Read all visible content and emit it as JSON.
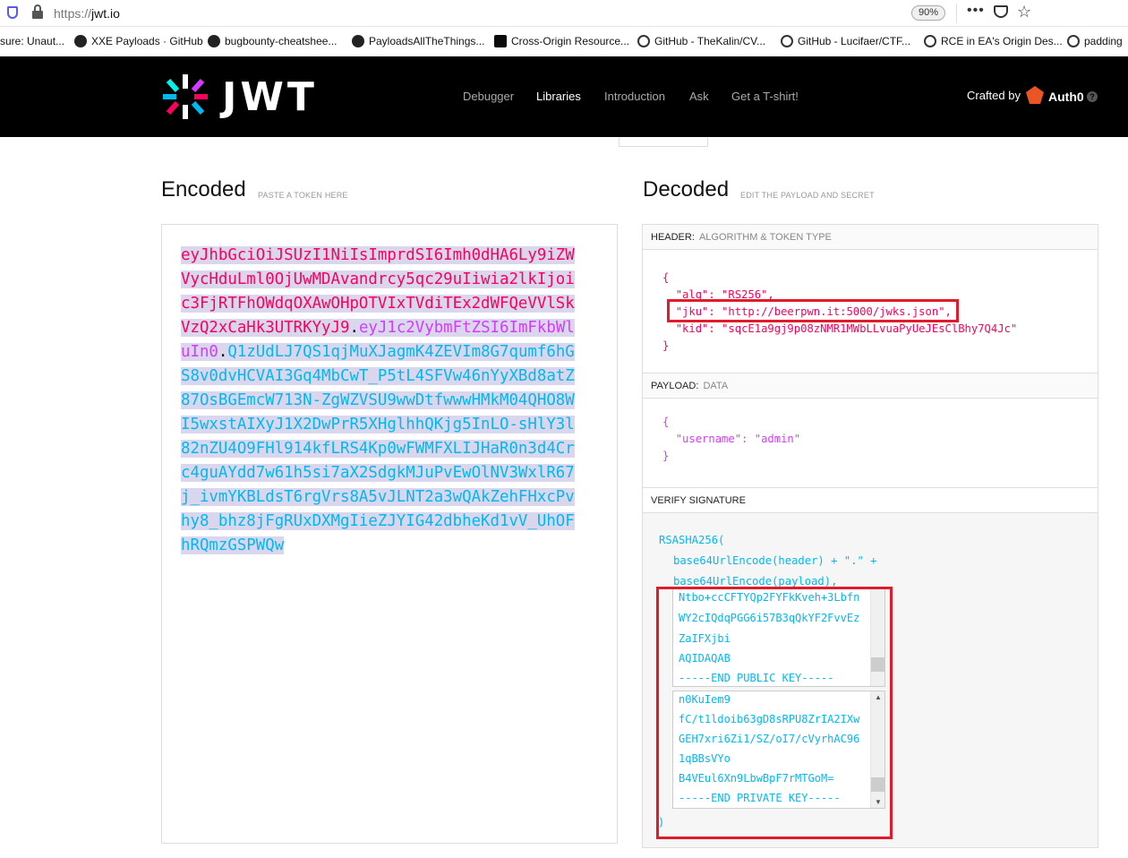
{
  "browser": {
    "url_scheme": "https://",
    "url_host": "jwt.io",
    "zoom": "90%",
    "bookmarks": [
      {
        "label": "sure: Unaut..."
      },
      {
        "label": "XXE Payloads · GitHub"
      },
      {
        "label": "bugbounty-cheatshee..."
      },
      {
        "label": "PayloadsAllTheThings..."
      },
      {
        "label": "Cross-Origin Resource..."
      },
      {
        "label": "GitHub - TheKalin/CV..."
      },
      {
        "label": "GitHub - Lucifaer/CTF..."
      },
      {
        "label": "RCE in EA's Origin Des..."
      },
      {
        "label": "padding"
      }
    ]
  },
  "nav": {
    "logo_text": "JWT",
    "links": {
      "debugger": "Debugger",
      "libraries": "Libraries",
      "introduction": "Introduction",
      "ask": "Ask",
      "tshirt": "Get a T-shirt!"
    },
    "crafted_by": "Crafted by",
    "auth0": "Auth0",
    "help": "?"
  },
  "encoded": {
    "title": "Encoded",
    "subtitle": "PASTE A TOKEN HERE",
    "header_part": "eyJhbGciOiJSUzI1NiIsImprdSI6Imh0dHA6Ly9iZWVycHduLml0OjUwMDAvandrcy5qc29uIiwia2lkIjoic3FjRTFhOWdqOXAwOHpOTVIxTVdiTEx2dWFQeVVlSkVzQ2xCaHk3UTRKYyJ9",
    "dot": ".",
    "payload_part": "eyJ1c2VybmFtZSI6ImFkbWluIn0",
    "signature_part": "Q1zUdLJ7QS1qjMuXJagmK4ZEVIm8G7qumf6hGS8v0dvHCVAI3Gq4MbCwT_P5tL4SFVw46nYyXBd8atZ87OsBGEmcW713N-ZgWZVSU9wwDtfwwwHMkM04QHO8WI5wxstAIXyJ1X2DwPrR5XHglhhQKjg5InLO-sHlY3l82nZU4O9FHl914kfLRS4Kp0wFWMFXLIJHaR0n3d4Crc4guAYdd7w61h5si7aX2SdgkMJuPvEwOlNV3WxlR67j_ivmYKBLdsT6rgVrs8A5vJLNT2a3wQAkZehFHxcPvhy8_bhz8jFgRUxDXMgIieZJYIG42dbheKd1vV_UhOFhRQmzGSPWQw"
  },
  "decoded": {
    "title": "Decoded",
    "subtitle": "EDIT THE PAYLOAD AND SECRET",
    "header": {
      "label": "HEADER:",
      "sublabel": "ALGORITHM & TOKEN TYPE",
      "open": "{",
      "close": "}",
      "alg_line": "\"alg\": \"RS256\",",
      "jku_key": "\"jku\":",
      "jku_val": "\"http://beerpwn.it:5000/jwks.json\",",
      "kid_key": "\"kid\":",
      "kid_val": "\"sqcE1a9gj9p08zNMR1MWbLLvuaPyUeJEsClBhy7Q4Jc\""
    },
    "payload": {
      "label": "PAYLOAD:",
      "sublabel": "DATA",
      "open": "{",
      "close": "}",
      "username_key": "\"username\":",
      "username_val": "\"admin\""
    },
    "verify": {
      "label": "VERIFY SIGNATURE",
      "line1": "RSASHA256(",
      "line2": "base64UrlEncode(header) + \".\" +",
      "line3": "base64UrlEncode(payload),",
      "public_key_lines": [
        "Ntbo+ccCFTYQp2FYFkKveh+3Lbfn",
        "WY2cIQdqPGG6i57B3qQkYF2FvvEz",
        "ZaIFXjbi",
        "AQIDAQAB",
        "-----END PUBLIC KEY-----"
      ],
      "private_key_lines": [
        "n0KuIem9",
        "fC/t1ldoib63gD8sRPU8ZrIA2IXw",
        "GEH7xri6Zi1/SZ/oI7/cVyrhAC96",
        "1qBBsVYo",
        "B4VEul6Xn9LbwBpF7rMTGoM=",
        "-----END PRIVATE KEY-----"
      ],
      "close": ")"
    }
  }
}
